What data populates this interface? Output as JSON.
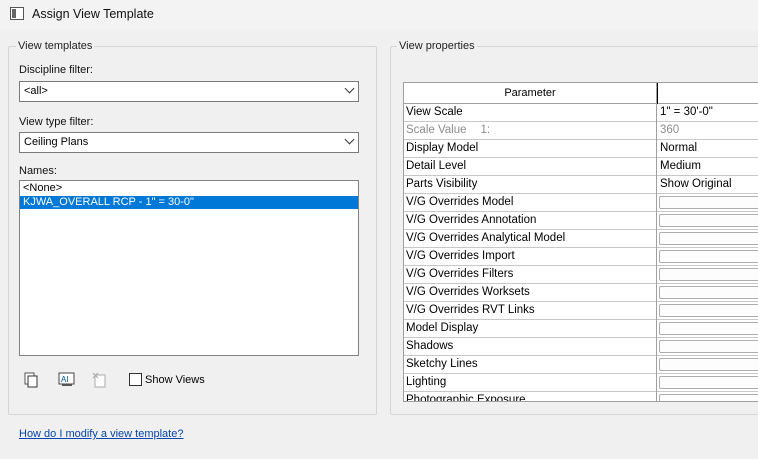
{
  "window": {
    "title": "Assign View Template"
  },
  "view_templates": {
    "group_label": "View templates",
    "discipline_filter": {
      "label": "Discipline filter:",
      "value": "<all>"
    },
    "view_type_filter": {
      "label": "View type filter:",
      "value": "Ceiling Plans"
    },
    "names": {
      "label": "Names:",
      "items": [
        "<None>",
        "KJWA_OVERALL RCP - 1\" = 30-0\""
      ],
      "selected_index": 1
    },
    "show_views_label": "Show Views"
  },
  "view_properties": {
    "group_label": "View properties",
    "columns": {
      "parameter": "Parameter",
      "value": ""
    },
    "rows": [
      {
        "parameter": "View Scale",
        "value": "1\" = 30'-0\""
      },
      {
        "parameter": "Scale Value",
        "suffix": "1:",
        "value": "360"
      },
      {
        "parameter": "Display Model",
        "value": "Normal"
      },
      {
        "parameter": "Detail Level",
        "value": "Medium"
      },
      {
        "parameter": "Parts Visibility",
        "value": "Show Original"
      },
      {
        "parameter": "V/G Overrides Model",
        "value": ""
      },
      {
        "parameter": "V/G Overrides Annotation",
        "value": ""
      },
      {
        "parameter": "V/G Overrides Analytical Model",
        "value": ""
      },
      {
        "parameter": "V/G Overrides Import",
        "value": ""
      },
      {
        "parameter": "V/G Overrides Filters",
        "value": ""
      },
      {
        "parameter": "V/G Overrides Worksets",
        "value": ""
      },
      {
        "parameter": "V/G Overrides RVT Links",
        "value": ""
      },
      {
        "parameter": "Model Display",
        "value": ""
      },
      {
        "parameter": "Shadows",
        "value": ""
      },
      {
        "parameter": "Sketchy Lines",
        "value": ""
      },
      {
        "parameter": "Lighting",
        "value": ""
      },
      {
        "parameter": "Photographic Exposure",
        "value": ""
      }
    ]
  },
  "help_link": "How do I modify a view template?",
  "colors": {
    "selection": "#0078d7",
    "link": "#0645ad"
  }
}
